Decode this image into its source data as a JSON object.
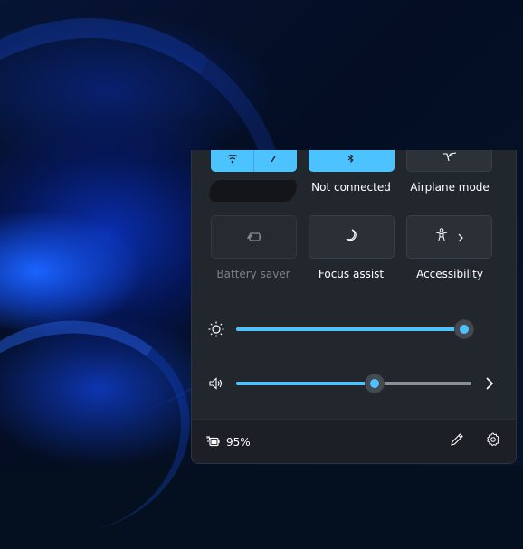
{
  "wallpaper": {
    "name": "Windows 11 Bloom dark"
  },
  "quick_settings": {
    "tiles": [
      {
        "id": "wifi",
        "icon": "wifi-icon",
        "label": "",
        "state": "on",
        "has_chevron": true,
        "label_redacted": true
      },
      {
        "id": "bluetooth",
        "icon": "bluetooth-icon",
        "label": "Not connected",
        "state": "on",
        "has_chevron": false
      },
      {
        "id": "airplane",
        "icon": "airplane-icon",
        "label": "Airplane mode",
        "state": "off",
        "has_chevron": false
      },
      {
        "id": "battery-saver",
        "icon": "battery-saver-icon",
        "label": "Battery saver",
        "state": "disabled",
        "has_chevron": false
      },
      {
        "id": "focus-assist",
        "icon": "moon-icon",
        "label": "Focus assist",
        "state": "off",
        "has_chevron": false
      },
      {
        "id": "accessibility",
        "icon": "accessibility-icon",
        "label": "Accessibility",
        "state": "off",
        "has_chevron": true
      }
    ],
    "brightness": {
      "icon": "sun-icon",
      "value_percent": 97
    },
    "volume": {
      "icon": "speaker-icon",
      "value_percent": 59,
      "has_chevron": true
    },
    "footer": {
      "battery_icon": "battery-charging-icon",
      "battery_text": "95%",
      "edit_icon": "pencil-icon",
      "settings_icon": "gear-icon"
    }
  },
  "colors": {
    "accent": "#4cc2ff",
    "panel_bg": "#22262d",
    "footer_bg": "#1c1f25",
    "tile_off_bg": "#2b2f36",
    "disabled_text": "#7d8188"
  }
}
